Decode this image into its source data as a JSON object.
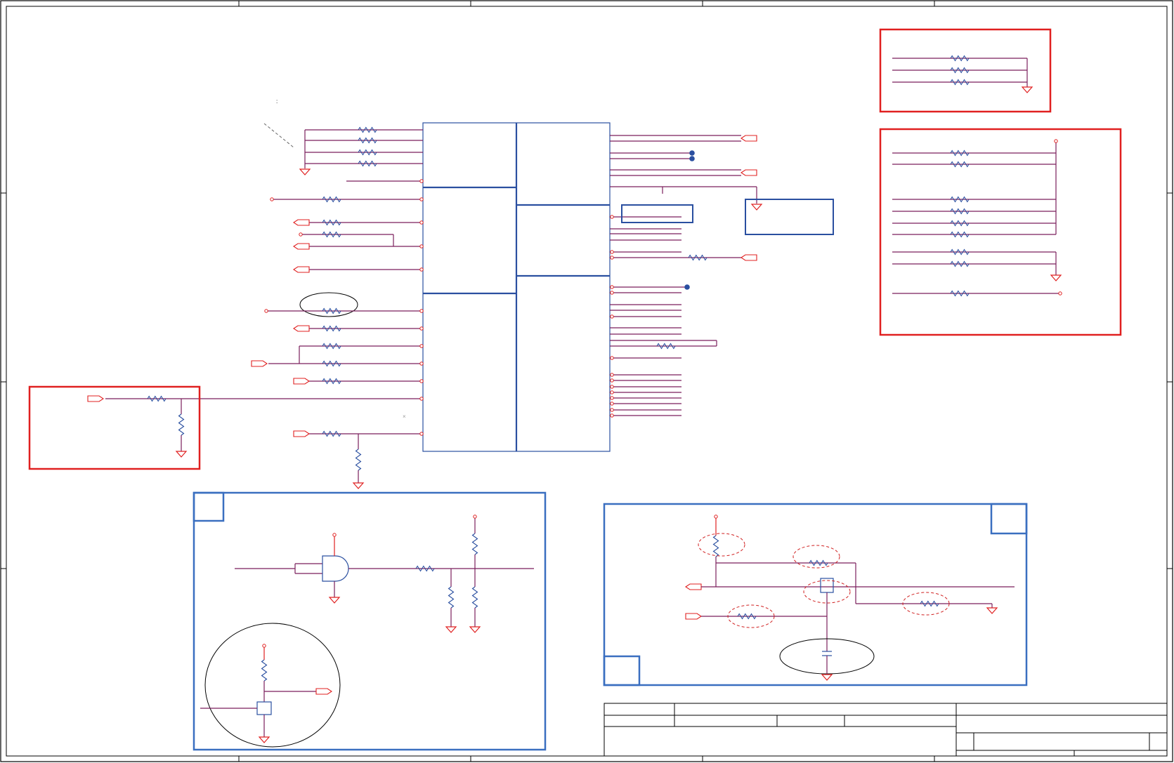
{
  "sheet": {
    "title": "",
    "border_color": "#000000",
    "frame_color": "#000000"
  },
  "colors": {
    "wire": "#7a1f5c",
    "pin": "#e02020",
    "block": "#2a4fa0",
    "highlight_box": "#e02020",
    "section_box": "#3a6fc0",
    "annotation": "#d02020",
    "text": "#000000"
  },
  "blocks": {
    "main_ic": {
      "label": ""
    },
    "mux": {
      "label": ""
    },
    "strap_box": {
      "label": ""
    },
    "red_box_top_right": {
      "label": ""
    },
    "red_box_right": {
      "label": ""
    },
    "red_box_left": {
      "label": ""
    },
    "blue_box_left": {
      "label": ""
    },
    "blue_box_right": {
      "label": ""
    }
  },
  "title_block": {
    "company": "",
    "title": "",
    "size": "",
    "doc_number": "",
    "rev": "",
    "date": "",
    "sheet": ""
  },
  "annotation_note": ":"
}
